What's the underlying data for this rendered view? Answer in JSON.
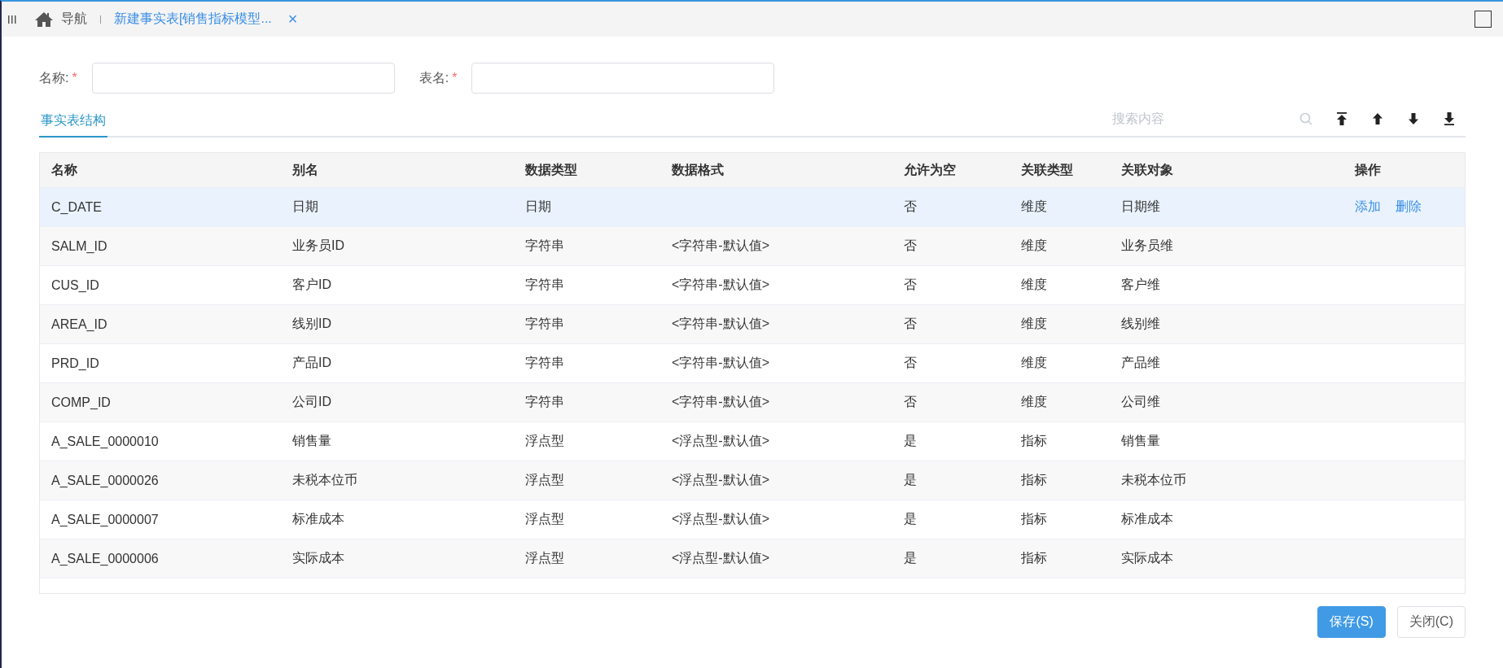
{
  "topbar": {
    "home_label": "导航",
    "tab_title": "新建事实表[销售指标模型...",
    "close_symbol": "×"
  },
  "form": {
    "fields": [
      {
        "label": "名称:",
        "required": true
      },
      {
        "label": "表名:",
        "required": true
      }
    ],
    "required_mark": "*"
  },
  "section_tabs": [
    {
      "label": "事实表结构",
      "selected": true
    }
  ],
  "search": {
    "placeholder": "搜索内容"
  },
  "table": {
    "columns": [
      "名称",
      "别名",
      "数据类型",
      "数据格式",
      "允许为空",
      "关联类型",
      "关联对象",
      "操作"
    ],
    "rows": [
      {
        "cells": [
          "C_DATE",
          "日期",
          "日期",
          null,
          "否",
          "维度",
          "日期维"
        ],
        "selected": true,
        "actions": [
          "添加",
          "删除"
        ]
      },
      {
        "cells": [
          "SALM_ID",
          "业务员ID",
          "字符串",
          "<字符串-默认值>",
          "否",
          "维度",
          "业务员维"
        ],
        "selected": false
      },
      {
        "cells": [
          "CUS_ID",
          "客户ID",
          "字符串",
          "<字符串-默认值>",
          "否",
          "维度",
          "客户维"
        ],
        "selected": false
      },
      {
        "cells": [
          "AREA_ID",
          "线别ID",
          "字符串",
          "<字符串-默认值>",
          "否",
          "维度",
          "线别维"
        ],
        "selected": false
      },
      {
        "cells": [
          "PRD_ID",
          "产品ID",
          "字符串",
          "<字符串-默认值>",
          "否",
          "维度",
          "产品维"
        ],
        "selected": false
      },
      {
        "cells": [
          "COMP_ID",
          "公司ID",
          "字符串",
          "<字符串-默认值>",
          "否",
          "维度",
          "公司维"
        ],
        "selected": false
      },
      {
        "cells": [
          "A_SALE_0000010",
          "销售量",
          "浮点型",
          "<浮点型-默认值>",
          "是",
          "指标",
          "销售量"
        ],
        "selected": false
      },
      {
        "cells": [
          "A_SALE_0000026",
          "未税本位币",
          "浮点型",
          "<浮点型-默认值>",
          "是",
          "指标",
          "未税本位币"
        ],
        "selected": false
      },
      {
        "cells": [
          "A_SALE_0000007",
          "标准成本",
          "浮点型",
          "<浮点型-默认值>",
          "是",
          "指标",
          "标准成本"
        ],
        "selected": false
      },
      {
        "cells": [
          "A_SALE_0000006",
          "实际成本",
          "浮点型",
          "<浮点型-默认值>",
          "是",
          "指标",
          "实际成本"
        ],
        "selected": false
      }
    ]
  },
  "buttons": [
    {
      "label": "保存(S)",
      "kind": "primary"
    },
    {
      "label": "关闭(C)",
      "kind": "default"
    }
  ]
}
